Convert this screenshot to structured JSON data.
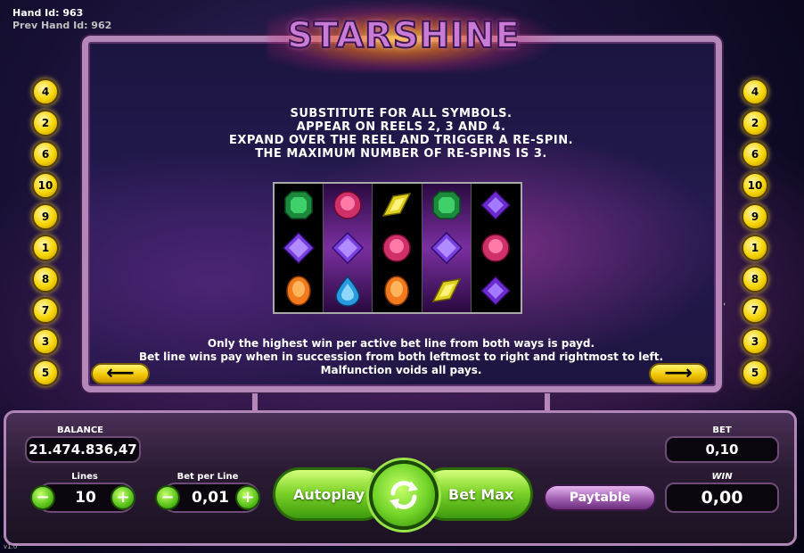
{
  "hand": {
    "hand_id": "Hand Id: 963",
    "prev_hand_id": "Prev Hand Id: 962"
  },
  "version": "v1.0",
  "logo": "STARSHINE",
  "description": [
    "SUBSTITUTE FOR ALL SYMBOLS.",
    "APPEAR ON REELS 2, 3 AND 4.",
    "EXPAND OVER THE REEL AND TRIGGER A RE-SPIN.",
    "THE MAXIMUM NUMBER OF RE-SPINS IS 3."
  ],
  "reels": [
    [
      "emerald",
      "starburst",
      "orange-oval"
    ],
    [
      "ruby-round",
      "starburst",
      "blue-drop"
    ],
    [
      "yellow-marquise",
      "ruby-round",
      "orange-oval"
    ],
    [
      "emerald",
      "starburst",
      "yellow-marquise"
    ],
    [
      "purple-square",
      "ruby-round",
      "purple-square"
    ]
  ],
  "rules": [
    "Only the highest win per active bet line from both ways is payd.",
    "Bet line wins pay when in succession from both leftmost to right and rightmost to left.",
    "Malfunction voids all pays."
  ],
  "line_markers_left": [
    "4",
    "2",
    "6",
    "10",
    "9",
    "1",
    "8",
    "7",
    "3",
    "5"
  ],
  "line_markers_right": [
    "4",
    "2",
    "6",
    "10",
    "9",
    "1",
    "8",
    "7",
    "3",
    "5"
  ],
  "controls": {
    "balance_label": "BALANCE",
    "balance_value": "21.474.836,47",
    "lines_label": "Lines",
    "lines_value": "10",
    "bet_per_line_label": "Bet per Line",
    "bet_per_line_value": "0,01",
    "autoplay_label": "Autoplay",
    "bet_max_label": "Bet Max",
    "paytable_label": "Paytable",
    "bet_label": "BET",
    "bet_value": "0,10",
    "win_label": "WIN",
    "win_value": "0,00",
    "minus": "−",
    "plus": "+"
  },
  "colors": {
    "panel_border": "#b487b8",
    "accent_green": "#58c21a",
    "accent_yellow": "#f5d400",
    "paytable_purple": "#a15fb2"
  },
  "icons": {
    "prev_page": "arrow-left-icon",
    "next_page": "arrow-right-icon",
    "spin": "refresh-arrows-icon"
  }
}
